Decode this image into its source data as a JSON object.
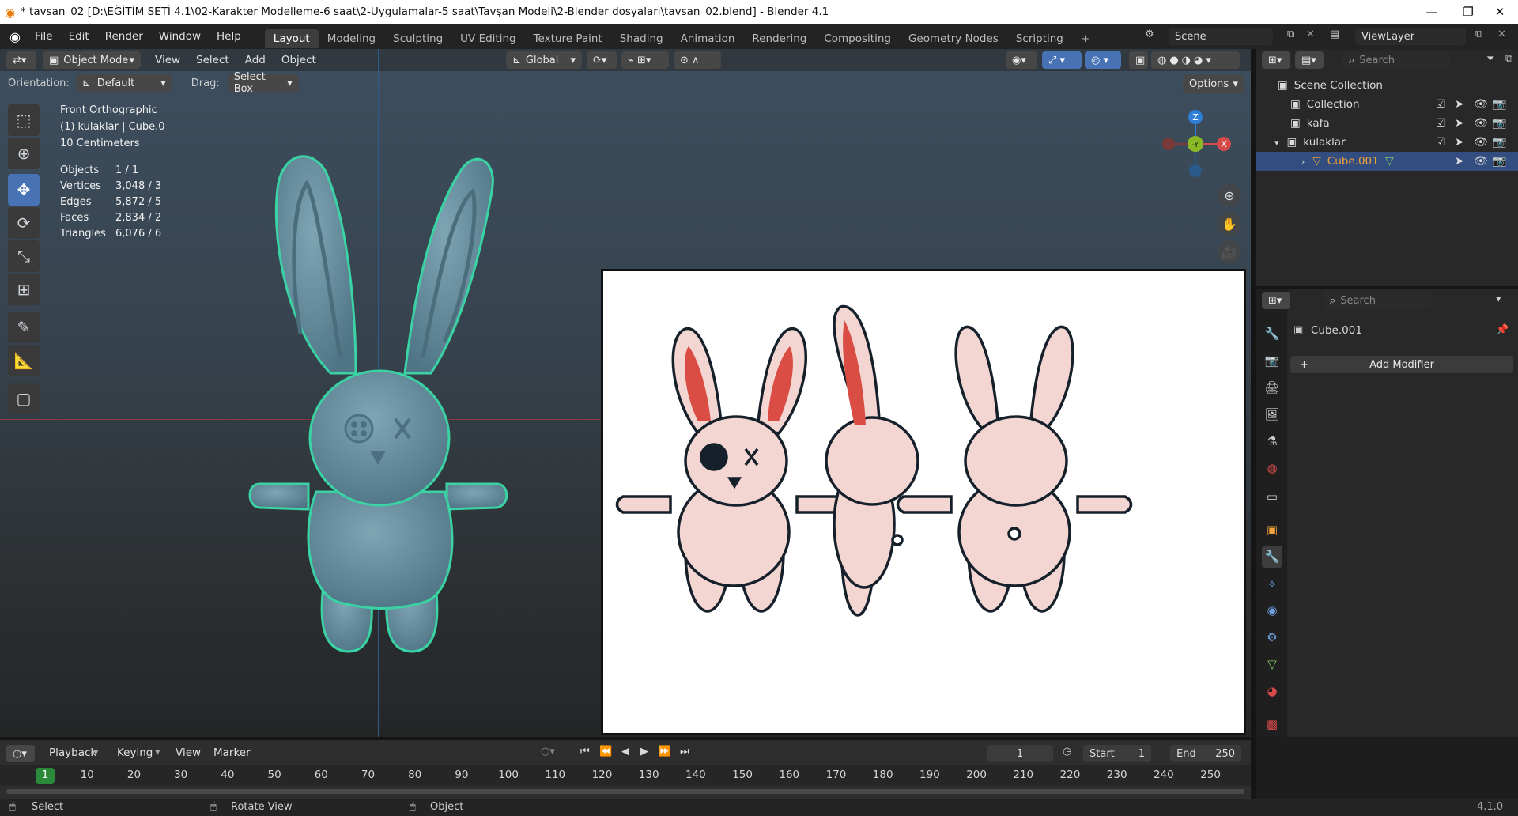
{
  "window": {
    "title": "* tavsan_02 [D:\\EĞİTİM SETİ 4.1\\02-Karakter Modelleme-6 saat\\2-Uygulamalar-5  saat\\Tavşan Modeli\\2-Blender dosyaları\\tavsan_02.blend] - Blender 4.1",
    "minimize": "—",
    "restore": "❐",
    "close": "✕"
  },
  "menu": [
    "File",
    "Edit",
    "Render",
    "Window",
    "Help"
  ],
  "workspaces": [
    "Layout",
    "Modeling",
    "Sculpting",
    "UV Editing",
    "Texture Paint",
    "Shading",
    "Animation",
    "Rendering",
    "Compositing",
    "Geometry Nodes",
    "Scripting"
  ],
  "active_workspace": "Layout",
  "scene": {
    "label": "Scene",
    "viewlayer": "ViewLayer"
  },
  "viewport": {
    "mode": "Object Mode",
    "menus": [
      "View",
      "Select",
      "Add",
      "Object"
    ],
    "transform_orientation": "Global",
    "orientation_label": "Orientation:",
    "orientation_value": "Default",
    "drag_label": "Drag:",
    "drag_value": "Select Box",
    "options": "Options",
    "view_name": "Front Orthographic",
    "collection_line": "(1) kulaklar | Cube.0",
    "scale": "10 Centimeters",
    "stats": [
      {
        "label": "Objects",
        "value": "1 / 1"
      },
      {
        "label": "Vertices",
        "value": "3,048 / 3"
      },
      {
        "label": "Edges",
        "value": "5,872 / 5"
      },
      {
        "label": "Faces",
        "value": "2,834 / 2"
      },
      {
        "label": "Triangles",
        "value": "6,076 / 6"
      }
    ],
    "gizmo": {
      "z": "Z",
      "y": "-Y",
      "x": "X"
    }
  },
  "outliner": {
    "search_placeholder": "Search",
    "items": [
      {
        "label": "Scene Collection"
      },
      {
        "label": "Collection"
      },
      {
        "label": "kafa"
      },
      {
        "label": "kulaklar"
      },
      {
        "label": "Cube.001"
      }
    ]
  },
  "properties": {
    "search_placeholder": "Search",
    "object_name": "Cube.001",
    "add_modifier": "Add Modifier"
  },
  "timeline": {
    "menus": [
      "Playback",
      "Keying",
      "View",
      "Marker"
    ],
    "current_frame": "1",
    "start_label": "Start",
    "start_value": "1",
    "end_label": "End",
    "end_value": "250",
    "frames": [
      "1",
      "10",
      "20",
      "30",
      "40",
      "50",
      "60",
      "70",
      "80",
      "90",
      "100",
      "110",
      "120",
      "130",
      "140",
      "150",
      "160",
      "170",
      "180",
      "190",
      "200",
      "210",
      "220",
      "230",
      "240",
      "250"
    ]
  },
  "status": {
    "select": "Select",
    "rotate": "Rotate View",
    "object": "Object",
    "version": "4.1.0"
  },
  "colors": {
    "accent": "#4772b3",
    "selection_outline": "#3ad3a4",
    "active_item": "#f0a33a",
    "mesh": "#5f8797",
    "sketch_pink": "#f2d0cc",
    "ear_red": "#d94d45"
  }
}
